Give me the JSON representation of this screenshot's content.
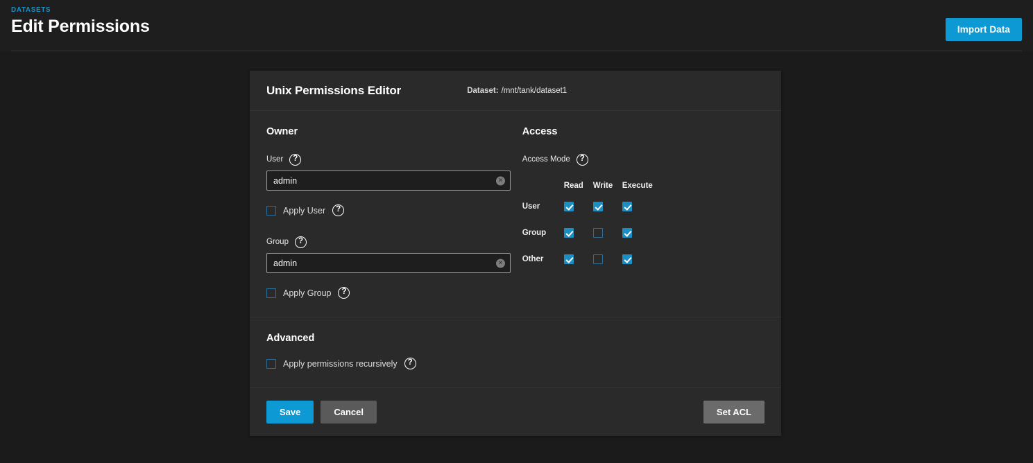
{
  "header": {
    "breadcrumb": "DATASETS",
    "title": "Edit Permissions",
    "import_label": "Import Data",
    "accent_color": "#0d99d4",
    "breadcrumb_color": "#1a8fc4"
  },
  "card": {
    "title": "Unix Permissions Editor",
    "dataset_label": "Dataset:",
    "dataset_path": "/mnt/tank/dataset1"
  },
  "owner": {
    "heading": "Owner",
    "user": {
      "label": "User",
      "value": "admin",
      "placeholder": "",
      "help_icon": "help-circle-icon",
      "clear_icon": "clear-circle-icon"
    },
    "apply_user": {
      "label": "Apply User",
      "checked": false,
      "help_icon": "help-circle-icon"
    },
    "group": {
      "label": "Group",
      "value": "admin",
      "placeholder": "",
      "help_icon": "help-circle-icon",
      "clear_icon": "clear-circle-icon"
    },
    "apply_group": {
      "label": "Apply Group",
      "checked": false,
      "help_icon": "help-circle-icon"
    }
  },
  "access": {
    "heading": "Access",
    "mode_label": "Access Mode",
    "help_icon": "help-circle-icon",
    "columns": [
      "Read",
      "Write",
      "Execute"
    ],
    "rows": [
      {
        "label": "User",
        "values": [
          true,
          true,
          true
        ]
      },
      {
        "label": "Group",
        "values": [
          true,
          false,
          true
        ]
      },
      {
        "label": "Other",
        "values": [
          true,
          false,
          true
        ]
      }
    ],
    "checked_color": "#1a8fc4"
  },
  "advanced": {
    "heading": "Advanced",
    "recursive": {
      "label": "Apply permissions recursively",
      "checked": false,
      "help_icon": "help-circle-icon"
    }
  },
  "footer": {
    "save_label": "Save",
    "cancel_label": "Cancel",
    "set_acl_label": "Set ACL"
  },
  "icons": {
    "help": "?",
    "clear": "×"
  }
}
